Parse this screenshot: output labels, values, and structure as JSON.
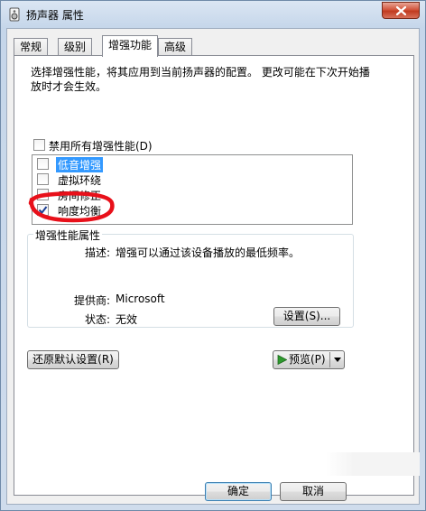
{
  "window": {
    "title": "扬声器 属性"
  },
  "tabs": [
    {
      "label": "常规"
    },
    {
      "label": "级别"
    },
    {
      "label": "增强功能"
    },
    {
      "label": "高级"
    }
  ],
  "panel": {
    "description": "选择增强性能，将其应用到当前扬声器的配置。 更改可能在下次开始播放时才会生效。",
    "disable_all_label": "禁用所有增强性能(D)",
    "disable_all_checked": false,
    "enhancements": [
      {
        "label": "低音增强",
        "checked": false,
        "selected": true
      },
      {
        "label": "虚拟环绕",
        "checked": false,
        "selected": false
      },
      {
        "label": "房间修正",
        "checked": false,
        "selected": false
      },
      {
        "label": "响度均衡",
        "checked": true,
        "selected": false
      }
    ],
    "properties": {
      "group_label": "增强性能属性",
      "description_label": "描述:",
      "description_value": "增强可以通过该设备播放的最低频率。",
      "provider_label": "提供商:",
      "provider_value": "Microsoft",
      "status_label": "状态:",
      "status_value": "无效",
      "settings_button": "设置(S)..."
    },
    "restore_defaults_button": "还原默认设置(R)",
    "preview_button": "预览(P)"
  },
  "footer": {
    "ok_button": "确定",
    "cancel_button": "取消"
  },
  "colors": {
    "selection": "#3399ff",
    "highlight_mark": "#e8101a",
    "close_button": "#c8452b"
  }
}
